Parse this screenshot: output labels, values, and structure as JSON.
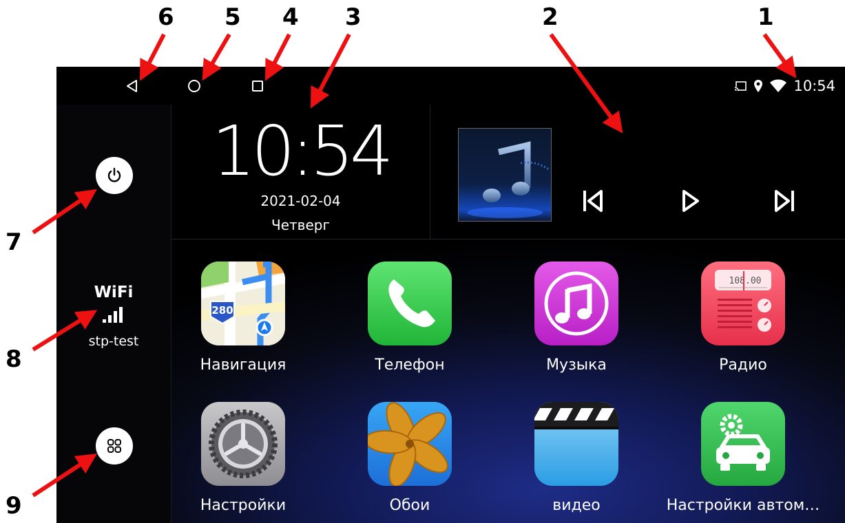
{
  "callouts": [
    "1",
    "2",
    "3",
    "4",
    "5",
    "6",
    "7",
    "8",
    "9"
  ],
  "status_bar": {
    "time": "10:54",
    "icons": [
      "cast-icon",
      "location-icon",
      "wifi-icon"
    ]
  },
  "nav_bar": {
    "buttons": [
      "back-button",
      "home-button",
      "recents-button"
    ]
  },
  "clock_widget": {
    "time": "10:54",
    "date": "2021-02-04",
    "day": "Четверг"
  },
  "music_widget": {
    "controls": [
      "previous-icon",
      "play-icon",
      "next-icon"
    ]
  },
  "sidebar": {
    "wifi_label": "WiFi",
    "wifi_ssid": "stp-test",
    "buttons": [
      "power-button",
      "all-apps-button"
    ]
  },
  "apps": [
    {
      "label": "Навигация",
      "icon": "maps-icon"
    },
    {
      "label": "Телефон",
      "icon": "phone-icon"
    },
    {
      "label": "Музыка",
      "icon": "music-icon"
    },
    {
      "label": "Радио",
      "icon": "radio-icon"
    },
    {
      "label": "Настройки",
      "icon": "settings-icon"
    },
    {
      "label": "Обои",
      "icon": "wallpaper-icon"
    },
    {
      "label": "видео",
      "icon": "video-icon"
    },
    {
      "label": "Настройки автом…",
      "icon": "car-settings-icon"
    }
  ],
  "icon_text": {
    "maps_shield": "280",
    "radio_freq": "108.00"
  },
  "colors": {
    "annotation_arrow": "#ee1111",
    "screen_bg": "#000000",
    "phone_green": "#2fcf4c",
    "music_pink": "#cf37d8",
    "radio_red": "#f0445a",
    "car_green": "#34c254"
  }
}
